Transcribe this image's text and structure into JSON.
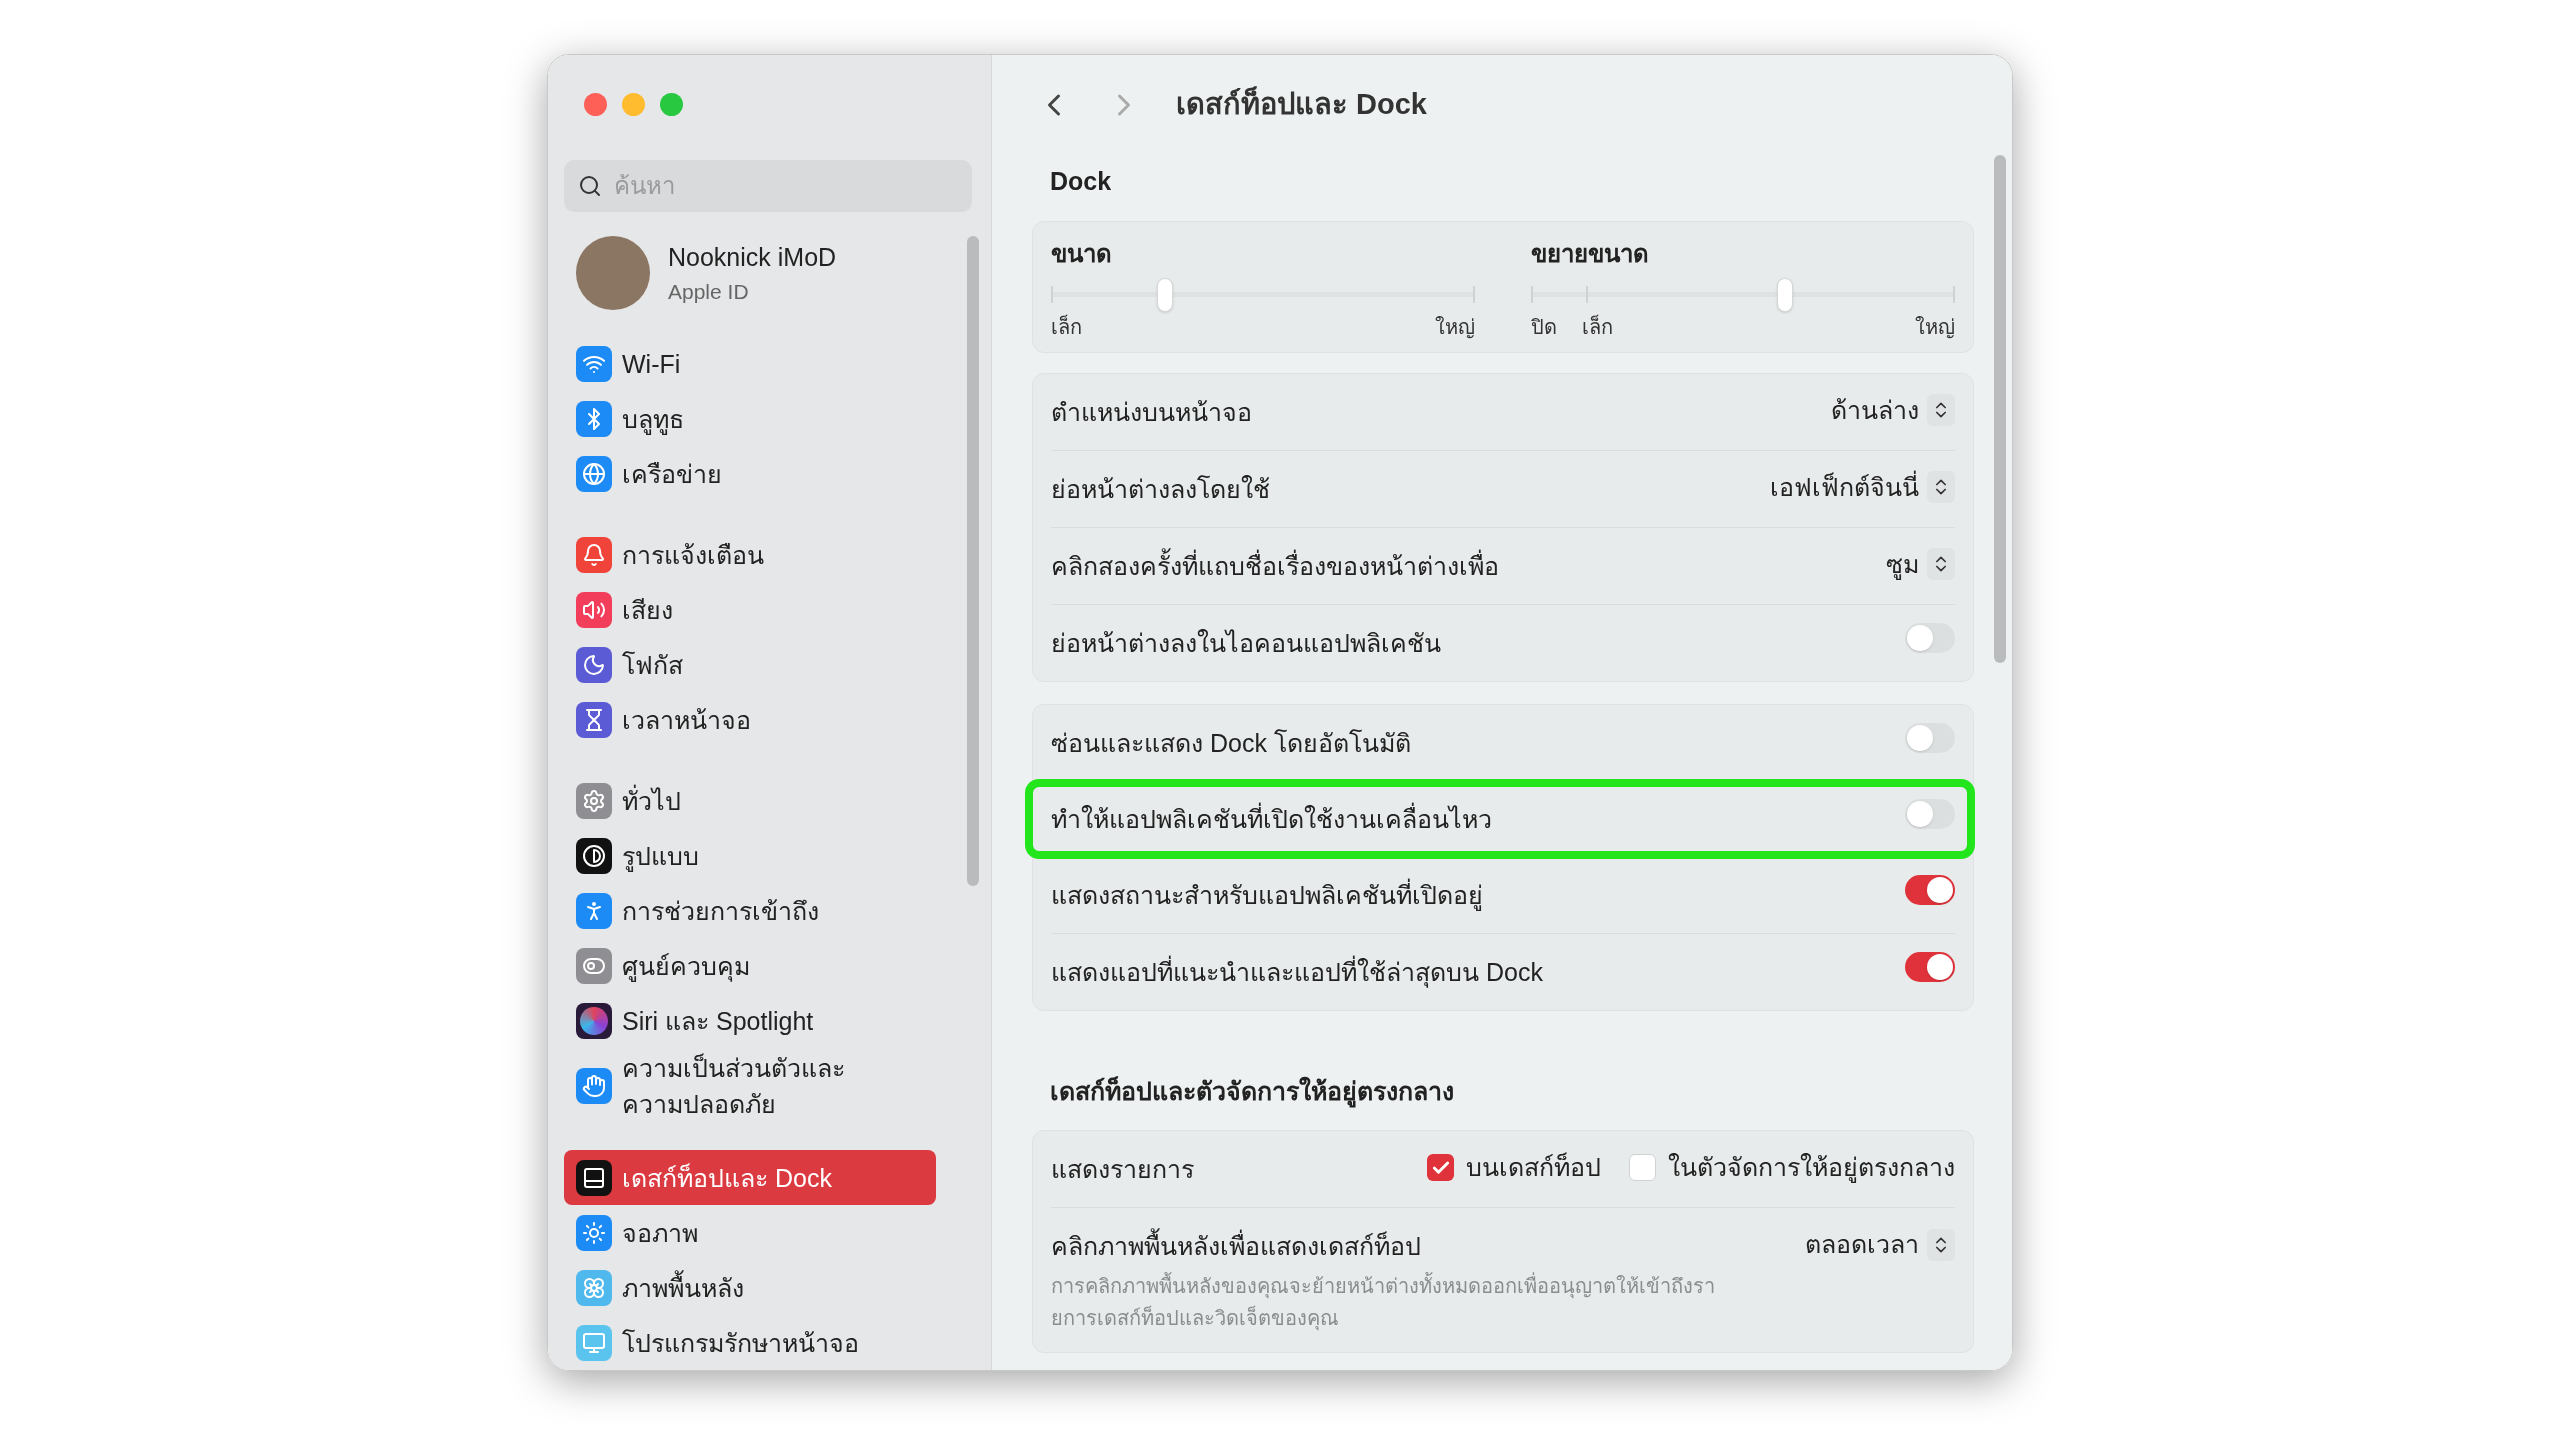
{
  "sidebar": {
    "search": {
      "placeholder": "ค้นหา"
    },
    "account": {
      "name": "Nooknick iMoD",
      "subtitle": "Apple ID"
    },
    "groups": [
      [
        {
          "label": "Wi-Fi",
          "kind": "wifi",
          "selected": false
        },
        {
          "label": "บลูทูธ",
          "kind": "bluetooth",
          "selected": false
        },
        {
          "label": "เครือข่าย",
          "kind": "network",
          "selected": false
        }
      ],
      [
        {
          "label": "การแจ้งเตือน",
          "kind": "notifications",
          "selected": false
        },
        {
          "label": "เสียง",
          "kind": "sound",
          "selected": false
        },
        {
          "label": "โฟกัส",
          "kind": "focus",
          "selected": false
        },
        {
          "label": "เวลาหน้าจอ",
          "kind": "screentime",
          "selected": false
        }
      ],
      [
        {
          "label": "ทั่วไป",
          "kind": "general",
          "selected": false
        },
        {
          "label": "รูปแบบ",
          "kind": "appearance",
          "selected": false
        },
        {
          "label": "การช่วยการเข้าถึง",
          "kind": "accessibility",
          "selected": false
        },
        {
          "label": "ศูนย์ควบคุม",
          "kind": "controlcenter",
          "selected": false
        },
        {
          "label": "Siri และ Spotlight",
          "kind": "siri",
          "selected": false
        },
        {
          "label": "ความเป็นส่วนตัวและ\nความปลอดภัย",
          "kind": "privacy",
          "selected": false
        }
      ],
      [
        {
          "label": "เดสก์ท็อปและ Dock",
          "kind": "dock",
          "selected": true
        },
        {
          "label": "จอภาพ",
          "kind": "display",
          "selected": false
        },
        {
          "label": "ภาพพื้นหลัง",
          "kind": "wallpaper",
          "selected": false
        },
        {
          "label": "โปรแกรมรักษาหน้าจอ",
          "kind": "screensaver",
          "selected": false
        }
      ]
    ]
  },
  "header": {
    "title": "เดสก์ท็อปและ Dock"
  },
  "sections": [
    {
      "title": "Dock",
      "cards": [
        {
          "kind": "sliders",
          "sliders": [
            {
              "label": "ขนาด",
              "level": 0.27,
              "tick_labels": [
                "เล็ก",
                "ใหญ่"
              ]
            },
            {
              "label": "ขยายขนาด",
              "level": 0.6,
              "tick_labels": [
                "ปิด",
                "เล็ก",
                "ใหญ่"
              ]
            }
          ]
        },
        {
          "kind": "rows",
          "rows": [
            {
              "kind": "select",
              "label": "ตำแหน่งบนหน้าจอ",
              "value": "ด้านล่าง",
              "highlighted": false
            },
            {
              "kind": "select",
              "label": "ย่อหน้าต่างลงโดยใช้",
              "value": "เอฟเฟ็กต์จินนี่",
              "highlighted": false
            },
            {
              "kind": "select",
              "label": "คลิกสองครั้งที่แถบชื่อเรื่องของหน้าต่างเพื่อ",
              "value": "ซูม",
              "highlighted": false
            },
            {
              "kind": "toggle",
              "label": "ย่อหน้าต่างลงในไอคอนแอปพลิเคชัน",
              "on": false,
              "highlighted": false
            }
          ]
        },
        {
          "kind": "rows",
          "rows": [
            {
              "kind": "toggle",
              "label": "ซ่อนและแสดง Dock โดยอัตโนมัติ",
              "on": false,
              "highlighted": false
            },
            {
              "kind": "toggle",
              "label": "ทำให้แอปพลิเคชันที่เปิดใช้งานเคลื่อนไหว",
              "on": false,
              "highlighted": true
            },
            {
              "kind": "toggle",
              "label": "แสดงสถานะสำหรับแอปพลิเคชันที่เปิดอยู่",
              "on": true,
              "highlighted": false
            },
            {
              "kind": "toggle",
              "label": "แสดงแอปที่แนะนำและแอปที่ใช้ล่าสุดบน Dock",
              "on": true,
              "highlighted": false
            }
          ]
        }
      ]
    },
    {
      "title": "เดสก์ท็อปและตัวจัดการให้อยู่ตรงกลาง",
      "cards": [
        {
          "kind": "rows",
          "rows": [
            {
              "kind": "checkboxes",
              "label": "แสดงรายการ",
              "options": [
                {
                  "label": "บนเดสก์ท็อป",
                  "checked": true
                },
                {
                  "label": "ในตัวจัดการให้อยู่ตรงกลาง",
                  "checked": false
                }
              ],
              "highlighted": false
            },
            {
              "kind": "select",
              "label": "คลิกภาพพื้นหลังเพื่อแสดงเดสก์ท็อป",
              "value": "ตลอดเวลา",
              "description": "การคลิกภาพพื้นหลังของคุณจะย้ายหน้าต่างทั้งหมดออกเพื่ออนุญาตให้เข้าถึงรา\nยการเดสก์ท็อปและวิดเจ็ตของคุณ",
              "highlighted": false
            }
          ]
        }
      ]
    }
  ]
}
